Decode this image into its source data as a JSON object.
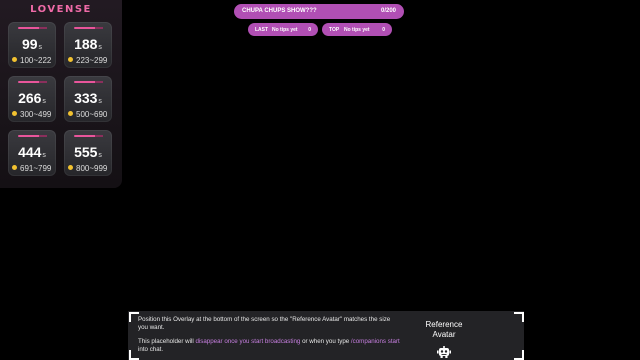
{
  "lovense": {
    "brand": "LOVENSE",
    "accent_color": "#e8559b",
    "coin_color": "#f2c230",
    "unit": "s",
    "levels": [
      {
        "amount": "99",
        "range": "100~222"
      },
      {
        "amount": "188",
        "range": "223~299"
      },
      {
        "amount": "266",
        "range": "300~499"
      },
      {
        "amount": "333",
        "range": "500~690"
      },
      {
        "amount": "444",
        "range": "691~799"
      },
      {
        "amount": "555",
        "range": "800~999"
      }
    ]
  },
  "goal": {
    "title": "CHUPA CHUPS SHOW???",
    "count": "0/200",
    "color": "#b14fb4"
  },
  "tips": {
    "last_label": "LAST",
    "last_text": "No tips yet",
    "last_value": "0",
    "top_label": "TOP",
    "top_text": "No tips yet",
    "top_value": "0"
  },
  "placeholder": {
    "line1": "Position this Overlay at the bottom of the screen so the \"Reference Avatar\" matches the size you want.",
    "line2_a": "This placeholder will ",
    "line2_b": "disappear once you start broadcasting",
    "line2_c": " or when you type ",
    "line2_d": "/companions start",
    "line2_e": " into chat.",
    "ref_line1": "Reference",
    "ref_line2": "Avatar",
    "avatar_icon": "robot-icon"
  }
}
